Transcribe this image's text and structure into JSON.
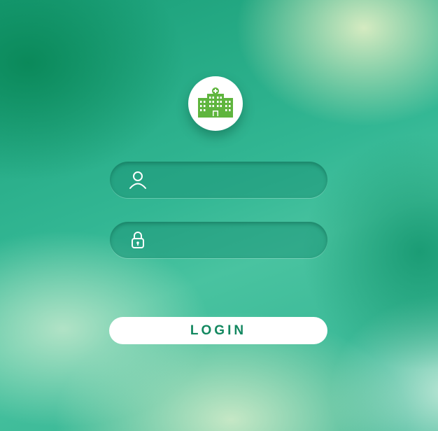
{
  "logo": {
    "icon": "hospital-building-icon",
    "color": "#5fb53e"
  },
  "username_field": {
    "icon": "user-icon",
    "value": ""
  },
  "password_field": {
    "icon": "lock-icon",
    "value": ""
  },
  "login_button": {
    "label": "LOGIN",
    "color": "#12875f"
  }
}
